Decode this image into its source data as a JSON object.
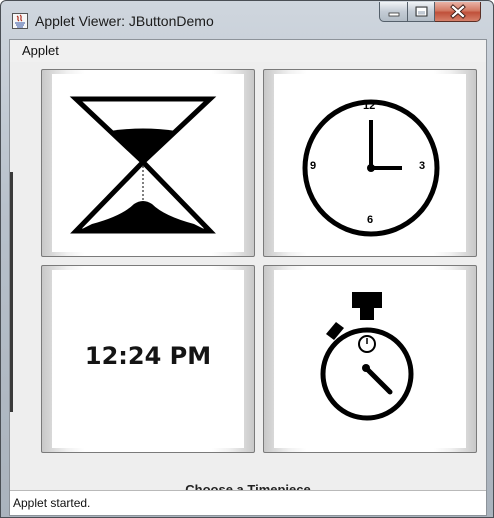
{
  "window": {
    "title": "Applet Viewer: JButtonDemo",
    "controls": [
      "minimize-icon",
      "maximize-icon",
      "close-icon"
    ]
  },
  "menubar": {
    "items": [
      {
        "label": "Applet"
      }
    ]
  },
  "buttons": [
    {
      "name": "hourglass-button",
      "icon": "hourglass-icon"
    },
    {
      "name": "analog-clock-button",
      "icon": "analog-clock-icon",
      "numerals": {
        "top": "12",
        "right": "3",
        "bottom": "6",
        "left": "9"
      }
    },
    {
      "name": "digital-clock-button",
      "icon": "digital-clock-icon",
      "text": "12:24 PM"
    },
    {
      "name": "stopwatch-button",
      "icon": "stopwatch-icon"
    }
  ],
  "caption": "Choose a Timepiece",
  "status": "Applet started."
}
